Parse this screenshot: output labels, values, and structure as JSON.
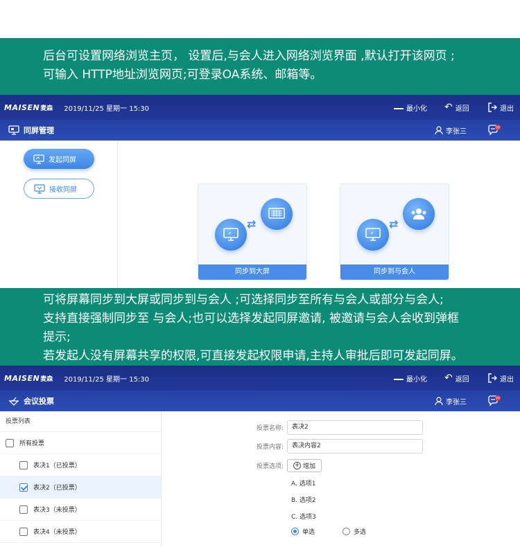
{
  "colors": {
    "banner_bg": "#0c8b76",
    "topbar": "#1f358f",
    "accent": "#3f86e6"
  },
  "banner1": {
    "line1": "后台可设置网络浏览主页， 设置后,与会人进入网络浏览界面 ,默认打开该网页 ;",
    "line2": "可输入 HTTP地址浏览网页;可登录OA系统、邮箱等。"
  },
  "banner2": {
    "line1": "可将屏幕同步到大屏或同步到与会人 ;可选择同步至所有与会人或部分与会人;",
    "line2": "支持直接强制同步至 与会人;也可以选择发起同屏邀请, 被邀请与会人会收到弹框",
    "line3": "提示;",
    "line4": "若发起人没有屏幕共享的权限,可直接发起权限申请,主持人审批后即可发起同屏。"
  },
  "app": {
    "logo": "MAISEN",
    "logo_cn": "麦森",
    "datetime": "2019/11/25   星期一   15:30",
    "minimize": "最小化",
    "back": "返回",
    "exit": "退出",
    "user": "李张三",
    "chat_badge": "99"
  },
  "screen1": {
    "title": "同屏管理",
    "btn_start": "发起同屏",
    "btn_receive": "接收同屏",
    "card_big": "同步到大屏",
    "card_people": "同步到与会人"
  },
  "screen2": {
    "title": "会议投票",
    "list_header": "投票列表",
    "all_votes": "所有投票",
    "items": [
      {
        "label": "表决1（已投票）",
        "checked": false
      },
      {
        "label": "表决2（已投票）",
        "checked": true
      },
      {
        "label": "表决3（未投票）",
        "checked": false
      },
      {
        "label": "表决4（未投票）",
        "checked": false
      }
    ],
    "name_label": "投票名称:",
    "name_value": "表决2",
    "content_label": "投票内容:",
    "content_value": "表决内容2",
    "options_label": "投票选项:",
    "add_label": "增加",
    "options": [
      "A.  选项1",
      "B.  选项2",
      "C.  选项3"
    ],
    "single": "单选",
    "multi": "多选"
  }
}
